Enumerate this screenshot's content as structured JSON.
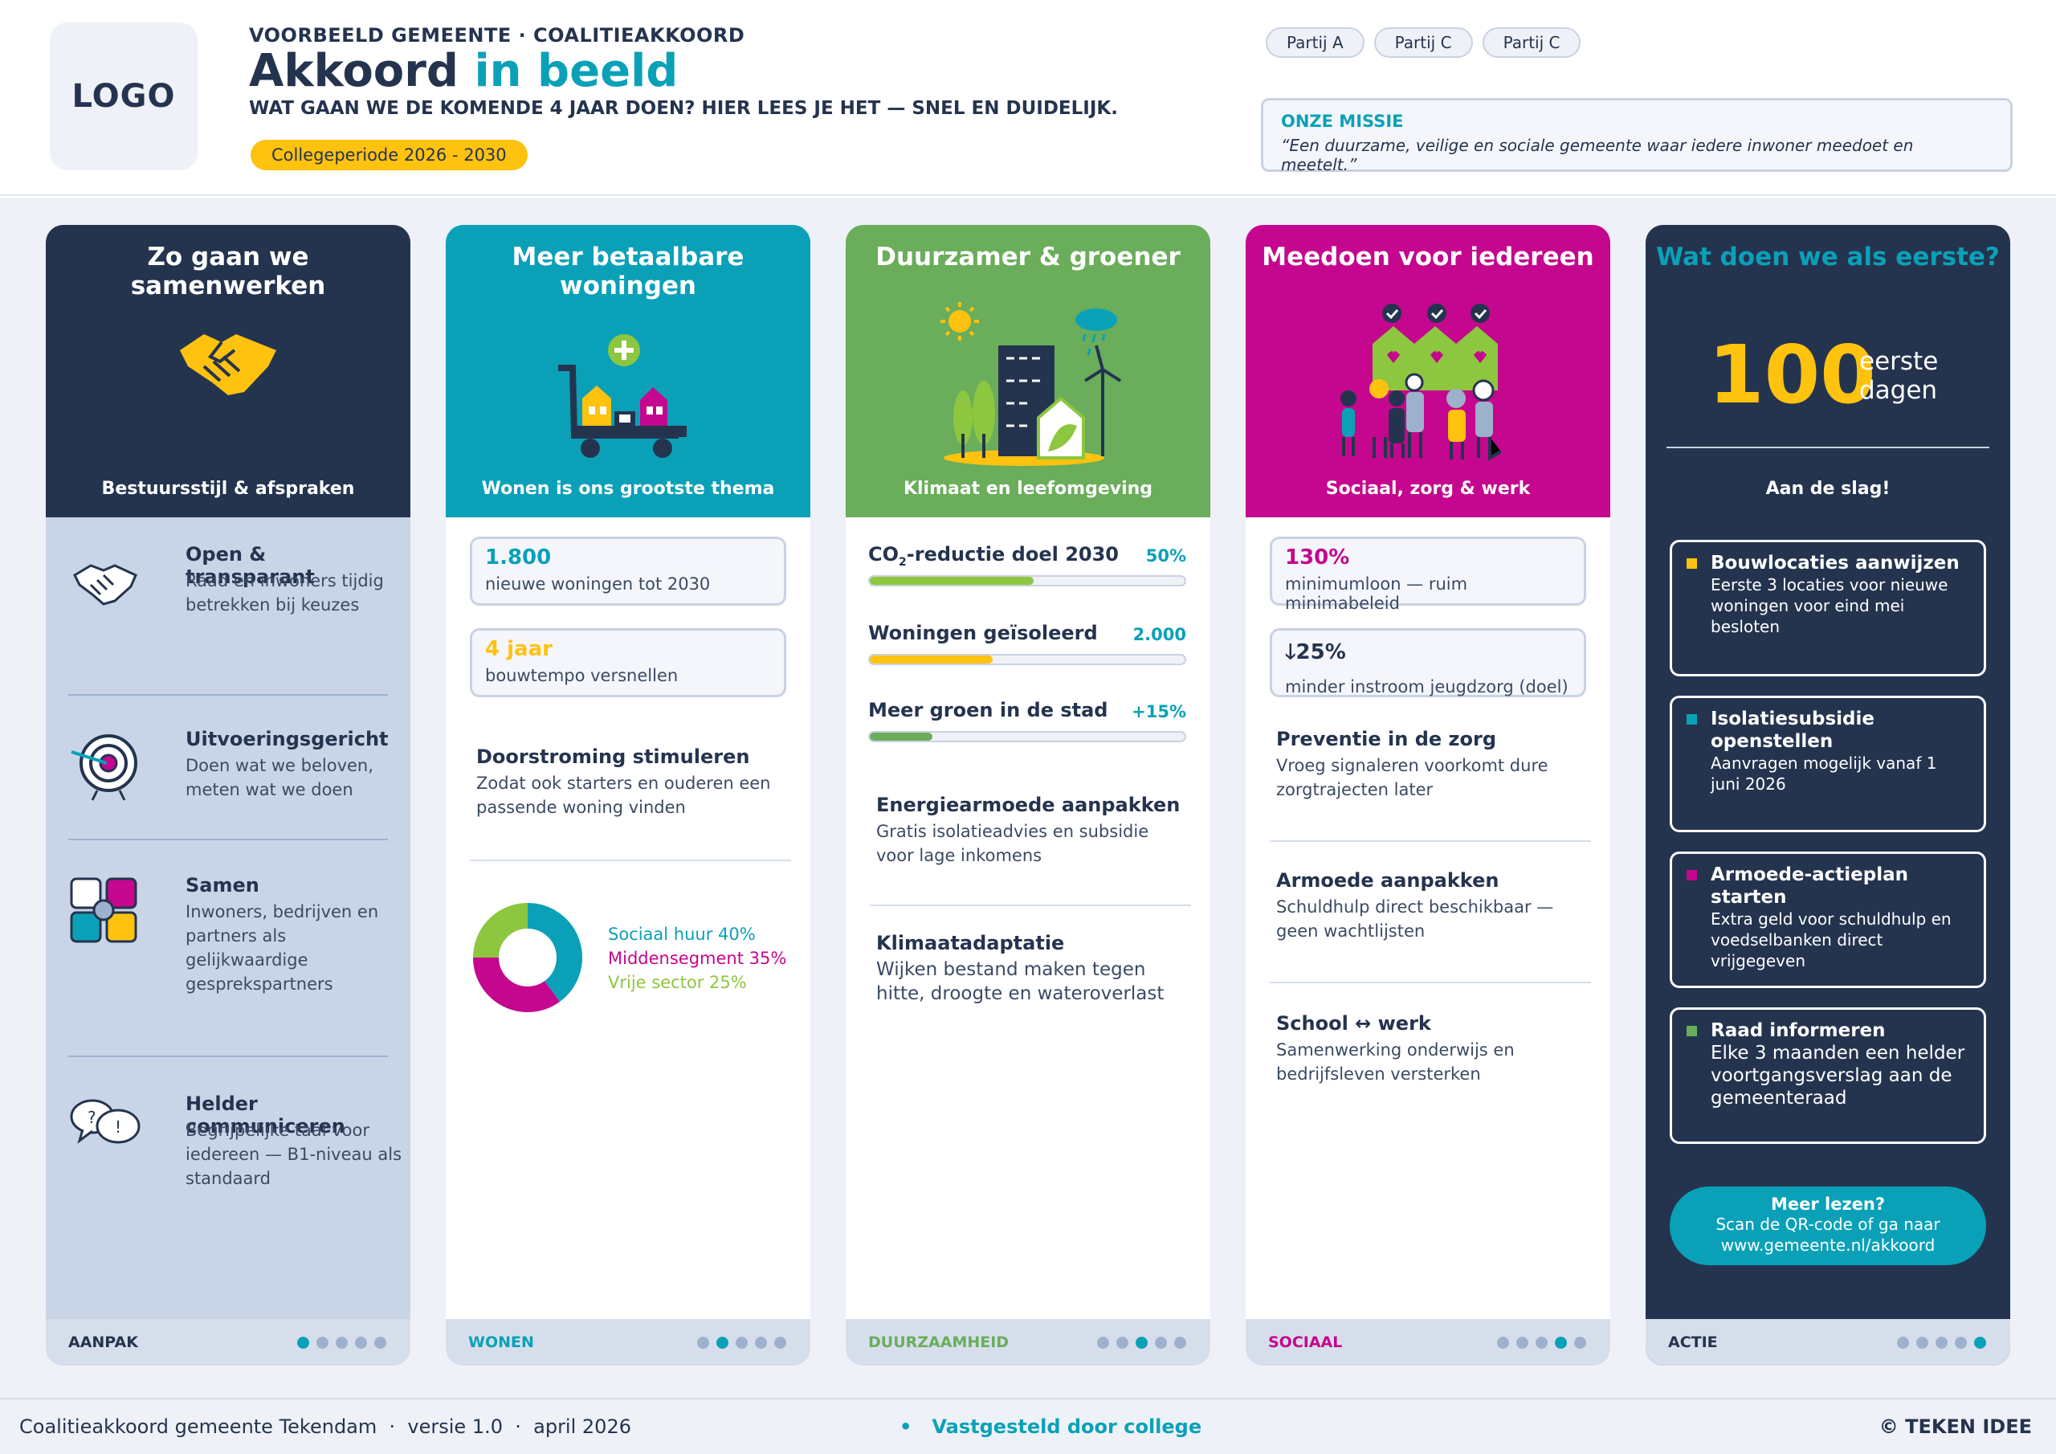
{
  "header": {
    "logo": "LOGO",
    "kicker": "VOORBEELD GEMEENTE · COALITIEAKKOORD",
    "title_main": "Akkoord",
    "title_accent": "in beeld",
    "subtitle": "WAT GAAN WE DE KOMENDE 4 JAAR DOEN? HIER LEES JE HET — SNEL EN DUIDELIJK.",
    "period": "Collegeperiode 2026 - 2030",
    "parties": [
      "Partij A",
      "Partij C",
      "Partij C"
    ],
    "mission_label": "ONZE MISSIE",
    "mission_text": "“Een duurzame, veilige en sociale gemeente waar iedere inwoner meedoet en meetelt.”"
  },
  "colors": {
    "navy": "#24344f",
    "teal": "#0aa1b8",
    "green": "#6aad5b",
    "magenta": "#c4078e",
    "yellow": "#ffc20e",
    "lime": "#8dc63f"
  },
  "card1": {
    "title": "Zo gaan we samenwerken",
    "icon": "handshake-icon",
    "subtitle": "Bestuursstijl & afspraken",
    "items": [
      {
        "title": "Open & transparant",
        "desc": "Raad en inwoners tijdig betrekken bij keuzes",
        "icon": "handshake-outline-icon"
      },
      {
        "title": "Uitvoeringsgericht",
        "desc": "Doen wat we beloven, meten wat we doen",
        "icon": "target-icon"
      },
      {
        "title": "Samen",
        "desc": "Inwoners, bedrijven en partners als gelijkwaardige gesprekspartners",
        "icon": "joined-hands-icon"
      },
      {
        "title": "Helder communiceren",
        "desc": "Begrijpelijke taal voor iedereen — B1-niveau als standaard",
        "icon": "speech-bubbles-icon"
      }
    ],
    "footer": "AANPAK",
    "active_dot": 1
  },
  "card2": {
    "title": "Meer betaalbare woningen",
    "icon": "houses-cart-icon",
    "subtitle": "Wonen is ons grootste thema",
    "stat1_value": "1.800",
    "stat1_label": "nieuwe woningen tot 2030",
    "stat2_value": "4 jaar",
    "stat2_label": "bouwtempo versnellen",
    "item_title": "Doorstroming stimuleren",
    "item_desc": "Zodat ook starters en ouderen een passende woning vinden",
    "legend": [
      "Sociaal huur 40%",
      "Middensegment 35%",
      "Vrije sector 25%"
    ],
    "footer": "WONEN",
    "active_dot": 2
  },
  "chart_data": {
    "type": "pie",
    "categories": [
      "Sociaal huur",
      "Middensegment",
      "Vrije sector"
    ],
    "values": [
      40,
      35,
      25
    ],
    "colors": [
      "#0aa1b8",
      "#c4078e",
      "#8dc63f"
    ]
  },
  "card3": {
    "title": "Duurzamer & groener",
    "icon": "city-climate-icon",
    "subtitle": "Klimaat en leefomgeving",
    "progress": [
      {
        "label_pre": "CO",
        "label_sub": "2",
        "label_post": "-reductie doel 2030",
        "value": "50%",
        "fraction": 0.52,
        "color": "#8dc63f",
        "value_color": "#0aa1b8"
      },
      {
        "label_pre": "Woningen geïsoleerd",
        "label_sub": "",
        "label_post": "",
        "value": "2.000",
        "fraction": 0.39,
        "color": "#ffc20e",
        "value_color": "#0aa1b8"
      },
      {
        "label_pre": "Meer groen in de stad",
        "label_sub": "",
        "label_post": "",
        "value": "+15%",
        "fraction": 0.2,
        "color": "#6aad5b",
        "value_color": "#0aa1b8"
      }
    ],
    "item1_title": "Energiearmoede aanpakken",
    "item1_desc": "Gratis isolatieadvies en subsidie voor lage inkomens",
    "item2_title": "Klimaatadaptatie",
    "item2_desc": "Wijken bestand maken tegen hitte, droogte en wateroverlast",
    "footer": "DUURZAAMHEID",
    "active_dot": 3
  },
  "card4": {
    "title": "Meedoen voor iedereen",
    "icon": "community-people-icon",
    "subtitle": "Sociaal, zorg & werk",
    "stat1_value": "130%",
    "stat1_label": "minimumloon — ruim minimabeleid",
    "stat2_value": "🡓25%",
    "stat2_label": "minder instroom jeugdzorg (doel)",
    "items": [
      {
        "title": "Preventie in de zorg",
        "desc": "Vroeg signaleren voorkomt dure zorgtrajecten later"
      },
      {
        "title": "Armoede aanpakken",
        "desc": "Schuldhulp direct beschikbaar — geen wachtlijsten"
      },
      {
        "title": "School ↔ werk",
        "desc": "Samenwerking onderwijs en bedrijfsleven versterken"
      }
    ],
    "footer": "SOCIAAL",
    "active_dot": 4
  },
  "card5": {
    "title": "Wat doen we als eerste?",
    "big_number": "100",
    "big_label_1": "eerste",
    "big_label_2": "dagen",
    "subtitle": "Aan de slag!",
    "actions": [
      {
        "title": "Bouwlocaties aanwijzen",
        "desc": "Eerste 3 locaties voor nieuwe woningen voor eind mei besloten",
        "color": "#ffc20e"
      },
      {
        "title": "Isolatiesubsidie openstellen",
        "desc": "Aanvragen mogelijk vanaf 1 juni 2026",
        "color": "#0aa1b8"
      },
      {
        "title": "Armoede-actieplan starten",
        "desc": "Extra geld voor schuldhulp en voedselbanken direct vrijgegeven",
        "color": "#c4078e"
      },
      {
        "title": "Raad informeren",
        "desc": "Elke 3 maanden een helder voortgangsverslag aan de gemeenteraad",
        "color": "#6aad5b"
      }
    ],
    "cta_title": "Meer lezen?",
    "cta_line1": "Scan de QR-code of ga naar",
    "cta_line2": "www.gemeente.nl/akkoord",
    "footer": "ACTIE",
    "active_dot": 5
  },
  "bottom": {
    "left": "Coalitieakkoord gemeente Tekendam  ·  versie 1.0  ·  april 2026",
    "middle": "•   Vastgesteld door college",
    "right": "© TEKEN IDEE"
  }
}
